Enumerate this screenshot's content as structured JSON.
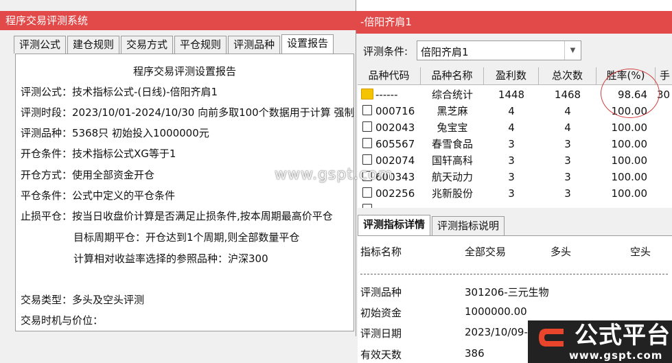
{
  "left": {
    "title": "程序交易评测系统",
    "tabs": [
      "评测公式",
      "建仓规则",
      "交易方式",
      "平仓规则",
      "评测品种",
      "设置报告"
    ],
    "report_title": "程序交易评测设置报告",
    "lines": [
      "评测公式：技术指标公式-(日线)-倍阳齐肩1",
      "评测时段：2023/10/01-2024/10/30 向前多取100个数据用于计算 强制",
      "评测品种：5368只 初始投入1000000元",
      "开仓条件：技术指标公式XG等于1",
      "开仓方式：使用全部资金开仓",
      "平仓条件：公式中定义的平仓条件",
      "止损平仓：按当日收盘价计算是否满足止损条件,按本周期最高价平仓",
      "目标周期平仓：开仓达到1个周期,则全部数量平仓",
      "计算相对收益率选择的参照品种：沪深300",
      "交易类型：多头及空头评测",
      "交易时机与价位："
    ]
  },
  "right": {
    "title": "-倍阳齐肩1",
    "condition_label": "评测条件:",
    "condition_value": "倍阳齐肩1",
    "headers": [
      "品种代码",
      "品种名称",
      "盈利数",
      "总次数",
      "胜率(%)",
      "手"
    ],
    "rows": [
      {
        "code": "------",
        "name": "综合统计",
        "profit": "1448",
        "total": "1468",
        "rate": "98.64",
        "extra": "30"
      },
      {
        "code": "000716",
        "name": "黑芝麻",
        "profit": "4",
        "total": "4",
        "rate": "100.00",
        "extra": ""
      },
      {
        "code": "002043",
        "name": "兔宝宝",
        "profit": "4",
        "total": "4",
        "rate": "100.00",
        "extra": ""
      },
      {
        "code": "605567",
        "name": "春雪食品",
        "profit": "3",
        "total": "3",
        "rate": "100.00",
        "extra": ""
      },
      {
        "code": "002074",
        "name": "国轩高科",
        "profit": "3",
        "total": "3",
        "rate": "100.00",
        "extra": ""
      },
      {
        "code": "600343",
        "name": "航天动力",
        "profit": "3",
        "total": "3",
        "rate": "100.00",
        "extra": ""
      },
      {
        "code": "002256",
        "name": "兆新股份",
        "profit": "3",
        "total": "3",
        "rate": "100.00",
        "extra": ""
      }
    ],
    "bottom_tabs": [
      "评测指标详情",
      "评测指标说明"
    ],
    "detail_headers": [
      "指标名称",
      "全部交易",
      "多头",
      "空头"
    ],
    "detail_rows": [
      {
        "label": "评测品种",
        "value": "301206-三元生物"
      },
      {
        "label": "初始资金",
        "value": "1000000.00"
      },
      {
        "label": "评测日期",
        "value": "2023/10/09-"
      },
      {
        "label": "有效天数",
        "value": "386"
      }
    ]
  },
  "watermark": "www.gspt.com",
  "logo": {
    "text": "公式平台",
    "url": "www.gspt.com",
    "accent": "#e8452c"
  }
}
